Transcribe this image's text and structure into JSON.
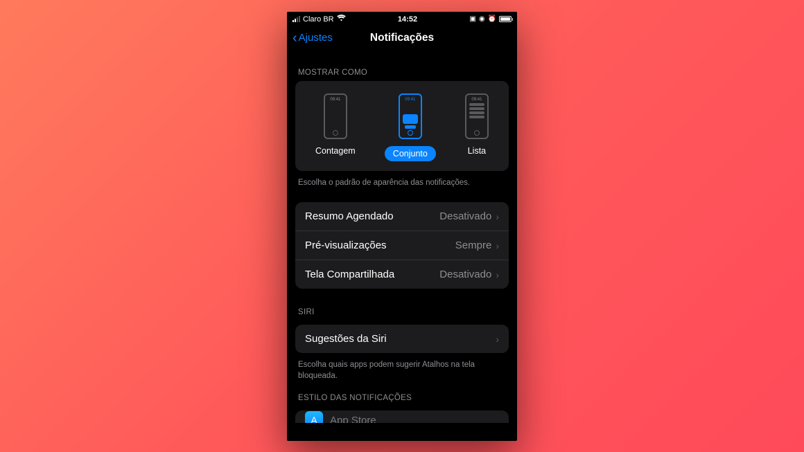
{
  "statusbar": {
    "carrier": "Claro BR",
    "time": "14:52"
  },
  "nav": {
    "back_label": "Ajustes",
    "title": "Notificações"
  },
  "display_as": {
    "header": "MOSTRAR COMO",
    "preview_time": "09:41",
    "modes": {
      "count": "Contagem",
      "stack": "Conjunto",
      "list": "Lista"
    },
    "footer": "Escolha o padrão de aparência das notificações."
  },
  "settings": {
    "scheduled_summary": {
      "label": "Resumo Agendado",
      "value": "Desativado"
    },
    "previews": {
      "label": "Pré-visualizações",
      "value": "Sempre"
    },
    "screen_sharing": {
      "label": "Tela Compartilhada",
      "value": "Desativado"
    }
  },
  "siri": {
    "header": "SIRI",
    "suggestions_label": "Sugestões da Siri",
    "footer": "Escolha quais apps podem sugerir Atalhos na tela bloqueada."
  },
  "style": {
    "header": "ESTILO DAS NOTIFICAÇÕES",
    "first_app": "App Store"
  }
}
